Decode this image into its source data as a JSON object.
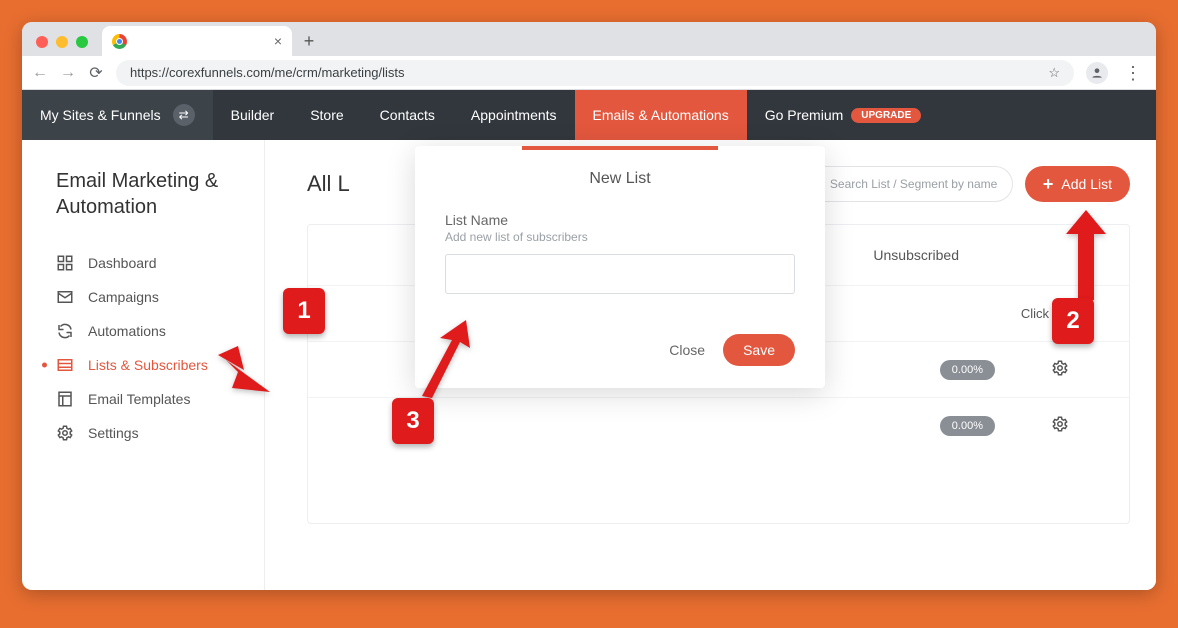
{
  "browser": {
    "url": "https://corexfunnels.com/me/crm/marketing/lists"
  },
  "topnav": {
    "brand": "My Sites & Funnels",
    "items": [
      "Builder",
      "Store",
      "Contacts",
      "Appointments",
      "Emails & Automations",
      "Go Premium"
    ],
    "upgrade_pill": "UPGRADE"
  },
  "sidebar": {
    "title": "Email Marketing & Automation",
    "items": [
      {
        "label": "Dashboard"
      },
      {
        "label": "Campaigns"
      },
      {
        "label": "Automations"
      },
      {
        "label": "Lists & Subscribers"
      },
      {
        "label": "Email Templates"
      },
      {
        "label": "Settings"
      }
    ]
  },
  "page": {
    "title": "All L",
    "search_placeholder": "Search List / Segment by name",
    "add_button": "Add List",
    "columns": {
      "unsubscribed": "Unsubscribed",
      "click_rate": "Click rate"
    },
    "rows": [
      {
        "rate": "0.00%"
      },
      {
        "rate": "0.00%"
      }
    ]
  },
  "modal": {
    "title": "New List",
    "field_label": "List Name",
    "field_sub": "Add new list of subscribers",
    "close": "Close",
    "save": "Save"
  },
  "annotations": {
    "one": "1",
    "two": "2",
    "three": "3"
  }
}
